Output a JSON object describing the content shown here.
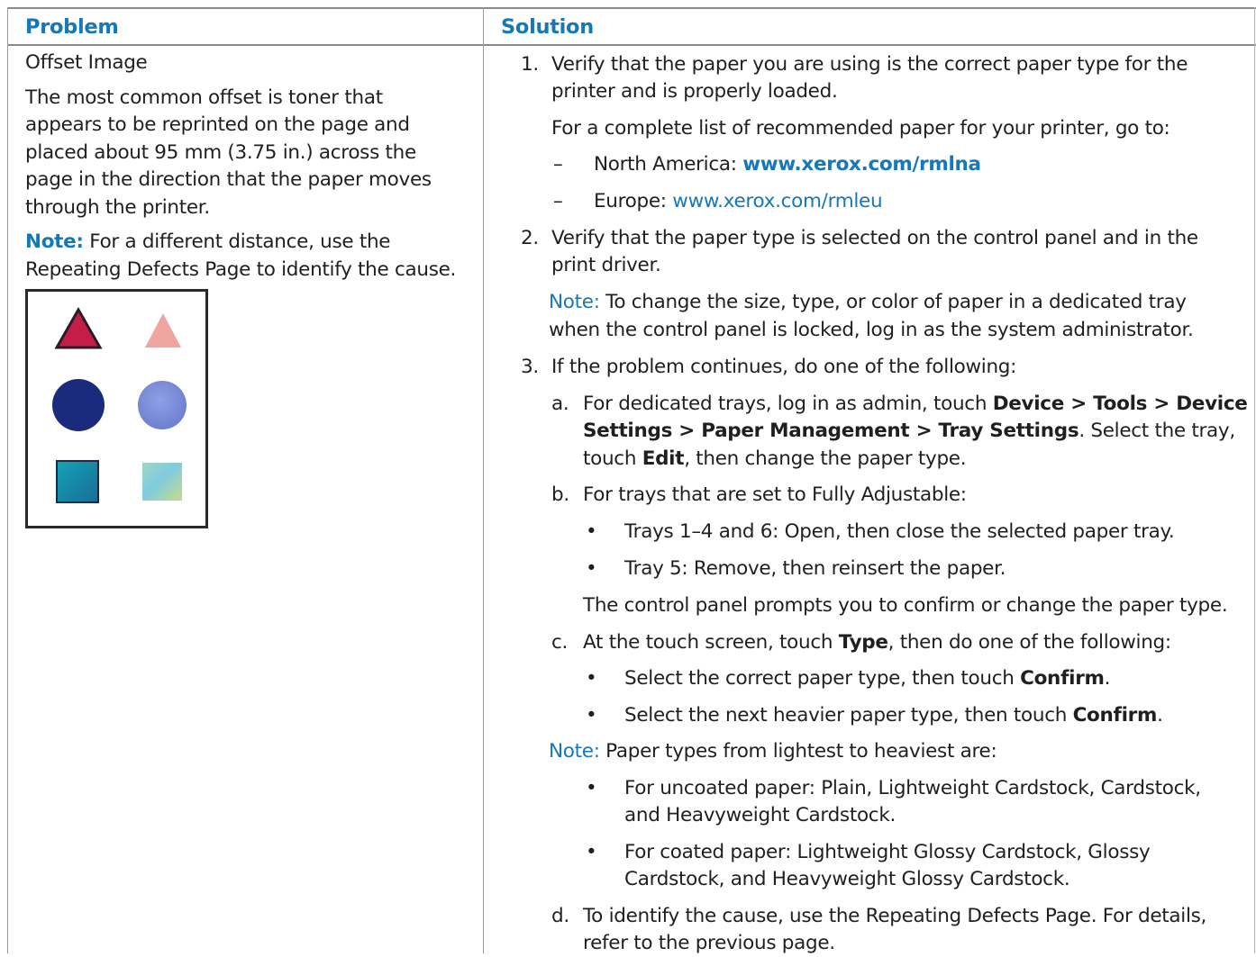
{
  "headers": {
    "problem": "Problem",
    "solution": "Solution"
  },
  "problem": {
    "title": "Offset Image",
    "body": [
      "The most common offset is toner that",
      "appears to be reprinted on the page and",
      "placed about 95 mm (3.75 in.) across the",
      "page in the direction that the paper moves",
      "through the printer."
    ],
    "note_label": "Note:",
    "note_line1": " For a different distance, use the",
    "note_line2": "Repeating Defects Page to identify the cause.",
    "figure": {
      "colors": {
        "triangle_dark": "#c41e47",
        "triangle_light": "#f0a5a0",
        "circle_dark": "#1c2a7e",
        "circle_light": "#7e8fd8",
        "square_dark": "#1a8fa6",
        "square_light": "#8fd0c0"
      },
      "icons": [
        "triangle-icon",
        "circle-icon",
        "square-icon"
      ]
    }
  },
  "solution": {
    "s1": {
      "num": "1.",
      "l1": "Verify that the paper you are using is the correct paper type for the",
      "l2": "printer and is properly loaded.",
      "l3": "For a complete list of recommended paper for your printer, go to:",
      "dash": "–",
      "na_label": "North America: ",
      "na_link": "www.xerox.com/rmlna",
      "eu_label": "Europe: ",
      "eu_link": "www.xerox.com/rmleu"
    },
    "s2": {
      "num": "2.",
      "l1": "Verify that the paper type is selected on the control panel and in the",
      "l2": "print driver.",
      "note_label": "Note:",
      "note_l1": " To change the size, type, or color of paper in a dedicated tray",
      "note_l2": "when the control panel is locked, log in as the system administrator."
    },
    "s3": {
      "num": "3.",
      "l1": "If the problem continues, do one of the following:",
      "a": {
        "letter": "a.",
        "l1_pre": "For dedicated trays, log in as admin, touch ",
        "l1_device": "Device",
        "sep1": " > ",
        "l1_tools": "Tools",
        "sep2": " > ",
        "l1_device2": "Device",
        "l2_settings": "Settings",
        "sep3": " > ",
        "l2_pm": "Paper Management",
        "sep4": " > ",
        "l2_ts": "Tray Settings",
        "l2_post": ". Select the tray,",
        "l3_pre": "touch ",
        "l3_edit": "Edit",
        "l3_post": ", then change the paper type."
      },
      "b": {
        "letter": "b.",
        "l1": "For trays that are set to Fully Adjustable:",
        "bullet": "•",
        "bl1": "Trays 1–4 and 6: Open, then close the selected paper tray.",
        "bl2": "Tray 5: Remove, then reinsert the paper.",
        "after": "The control panel prompts you to confirm or change the paper type."
      },
      "c": {
        "letter": "c.",
        "l1_pre": "At the touch screen, touch ",
        "l1_type": "Type",
        "l1_post": ", then do one of the following:",
        "bl1_pre": "Select the correct paper type, then touch ",
        "bl1_b": "Confirm",
        "bl1_post": ".",
        "bl2_pre": "Select the next heavier paper type, then touch ",
        "bl2_b": "Confirm",
        "bl2_post": "."
      },
      "note": {
        "label": "Note:",
        "text": " Paper types from lightest to heaviest are:",
        "bl1_l1": "For uncoated paper: Plain, Lightweight Cardstock, Cardstock,",
        "bl1_l2": "and Heavyweight Cardstock.",
        "bl2_l1": "For coated paper: Lightweight Glossy Cardstock, Glossy",
        "bl2_l2": "Cardstock, and Heavyweight Glossy Cardstock."
      },
      "d": {
        "letter": "d.",
        "l1": "To identify the cause, use the Repeating Defects Page. For details,",
        "l2": "refer to the previous page."
      }
    }
  }
}
